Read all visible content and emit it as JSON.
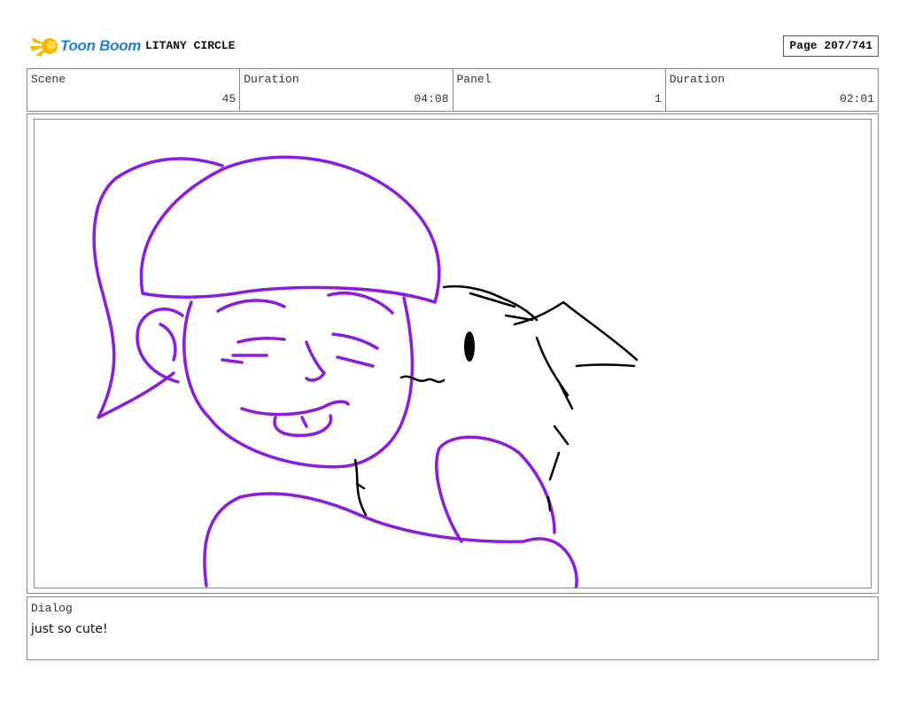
{
  "header": {
    "logo_text": "Toon Boom",
    "project_title": "LITANY CIRCLE",
    "page_label": "Page 207/741"
  },
  "info": {
    "scene_label": "Scene",
    "scene_value": "45",
    "scene_duration_label": "Duration",
    "scene_duration_value": "04:08",
    "panel_label": "Panel",
    "panel_value": "1",
    "panel_duration_label": "Duration",
    "panel_duration_value": "02:01"
  },
  "dialog": {
    "label": "Dialog",
    "text": "just so cute!"
  },
  "colors": {
    "logo_blue": "#1f7fd0",
    "logo_yellow": "#f5b800",
    "sketch_purple": "#8a1be0",
    "sketch_black": "#000000",
    "border": "#888888"
  }
}
